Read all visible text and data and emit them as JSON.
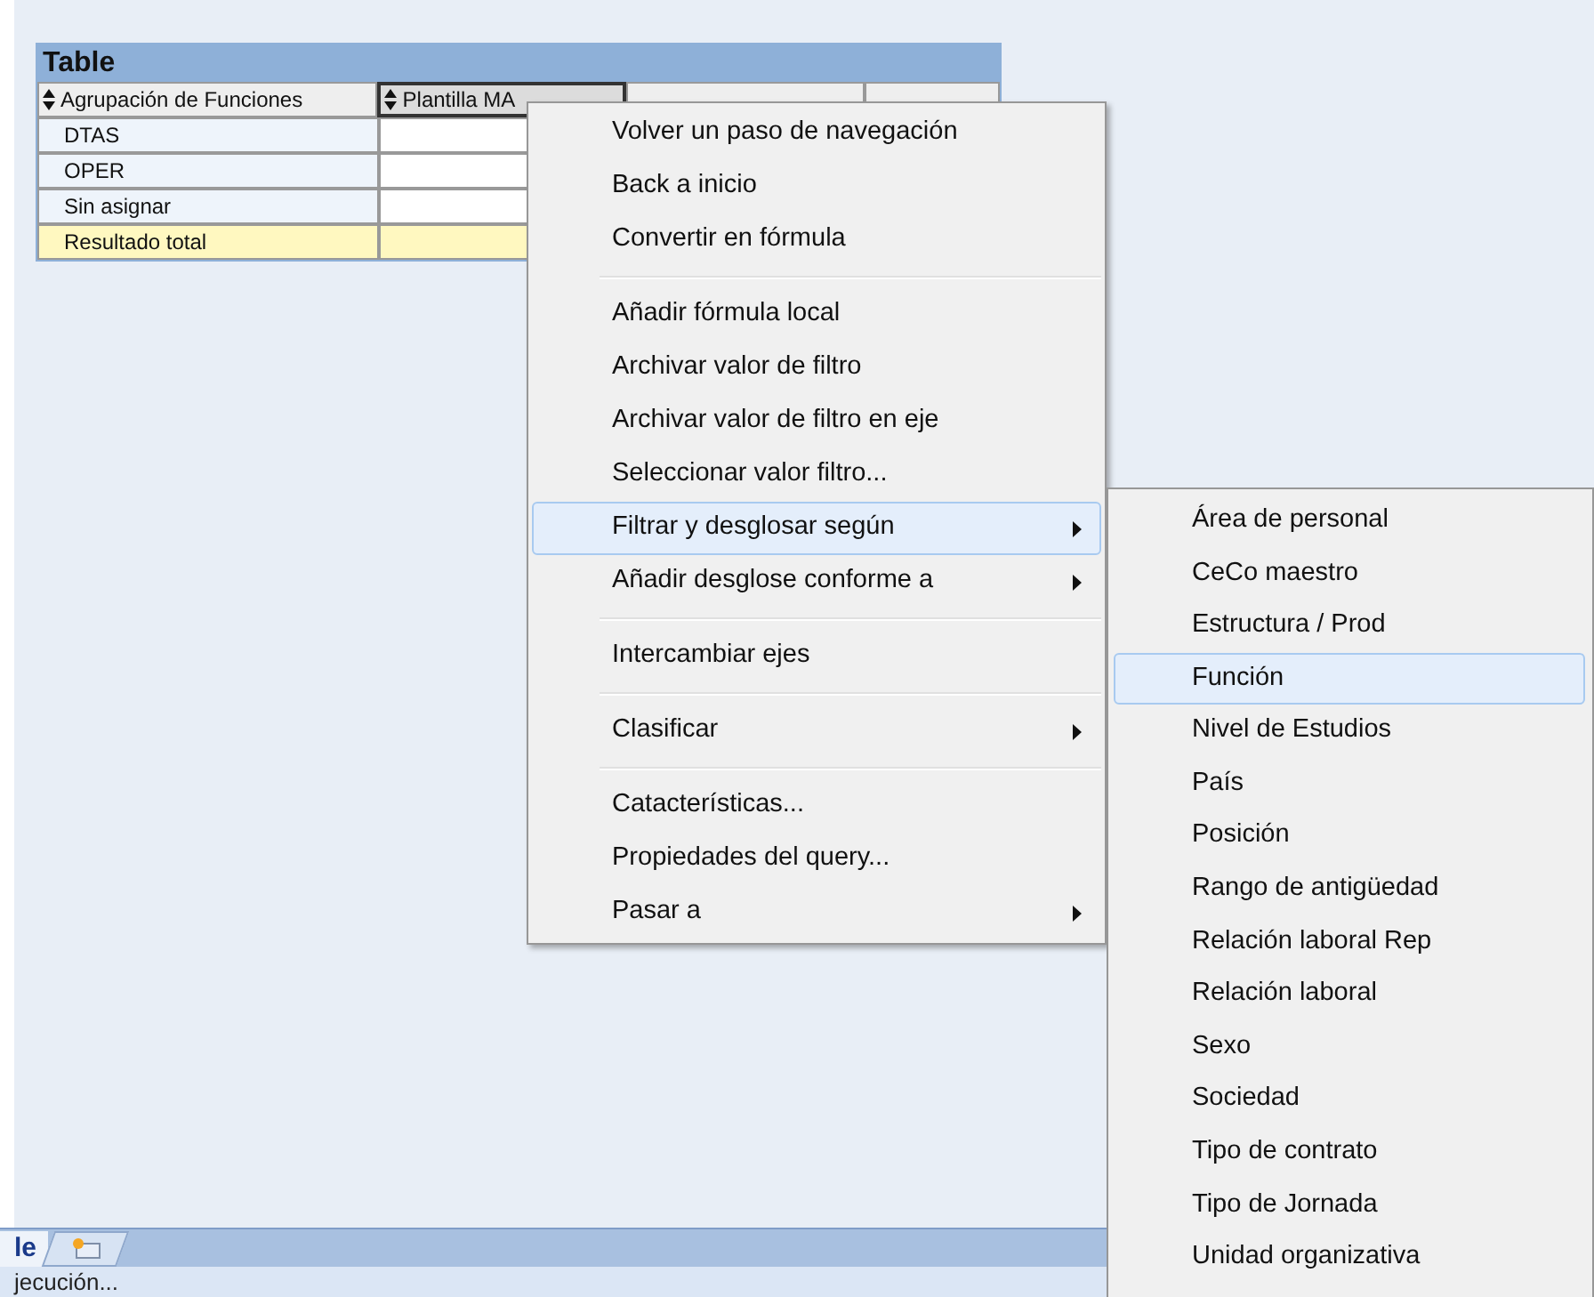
{
  "table": {
    "title": "Table",
    "columns": [
      {
        "label": "Agrupación de Funciones",
        "selected": false
      },
      {
        "label": "Plantilla MA",
        "selected": true
      },
      {
        "selected": false
      },
      {
        "selected": false
      }
    ],
    "rows": [
      {
        "label": "DTAS",
        "kind": "data"
      },
      {
        "label": "OPER",
        "kind": "data"
      },
      {
        "label": "Sin asignar",
        "kind": "data"
      },
      {
        "label": "Resultado total",
        "kind": "total"
      }
    ]
  },
  "context_menu": {
    "items": [
      {
        "kind": "item",
        "label": "Volver un paso de navegación",
        "submenu": false,
        "selected": false
      },
      {
        "kind": "item",
        "label": "Back a inicio",
        "submenu": false,
        "selected": false
      },
      {
        "kind": "item",
        "label": "Convertir en fórmula",
        "submenu": false,
        "selected": false
      },
      {
        "kind": "separator"
      },
      {
        "kind": "item",
        "label": "Añadir fórmula local",
        "submenu": false,
        "selected": false
      },
      {
        "kind": "item",
        "label": "Archivar valor de filtro",
        "submenu": false,
        "selected": false
      },
      {
        "kind": "item",
        "label": "Archivar valor de filtro en eje",
        "submenu": false,
        "selected": false
      },
      {
        "kind": "item",
        "label": "Seleccionar valor filtro...",
        "submenu": false,
        "selected": false
      },
      {
        "kind": "item",
        "label": "Filtrar y desglosar según",
        "submenu": true,
        "selected": true
      },
      {
        "kind": "item",
        "label": "Añadir desglose conforme a",
        "submenu": true,
        "selected": false
      },
      {
        "kind": "separator"
      },
      {
        "kind": "item",
        "label": "Intercambiar ejes",
        "submenu": false,
        "selected": false
      },
      {
        "kind": "separator"
      },
      {
        "kind": "item",
        "label": "Clasificar",
        "submenu": true,
        "selected": false
      },
      {
        "kind": "separator"
      },
      {
        "kind": "item",
        "label": "Catacterísticas...",
        "submenu": false,
        "selected": false
      },
      {
        "kind": "item",
        "label": "Propiedades del query...",
        "submenu": false,
        "selected": false
      },
      {
        "kind": "item",
        "label": "Pasar a",
        "submenu": true,
        "selected": false
      }
    ]
  },
  "submenu": {
    "items": [
      {
        "label": "Área de personal",
        "selected": false
      },
      {
        "label": "CeCo maestro",
        "selected": false
      },
      {
        "label": "Estructura / Prod",
        "selected": false
      },
      {
        "label": "Función",
        "selected": true
      },
      {
        "label": "Nivel de Estudios",
        "selected": false
      },
      {
        "label": "País",
        "selected": false
      },
      {
        "label": "Posición",
        "selected": false
      },
      {
        "label": "Rango de antigüedad",
        "selected": false
      },
      {
        "label": "Relación laboral Rep",
        "selected": false
      },
      {
        "label": "Relación laboral",
        "selected": false
      },
      {
        "label": "Sexo",
        "selected": false
      },
      {
        "label": "Sociedad",
        "selected": false
      },
      {
        "label": "Tipo de contrato",
        "selected": false
      },
      {
        "label": "Tipo de Jornada",
        "selected": false
      },
      {
        "label": "Unidad organizativa",
        "selected": false
      }
    ]
  },
  "sheet_tabs": [
    {
      "label": "le",
      "selected": true
    }
  ],
  "status_bar": {
    "text": "jecución..."
  }
}
